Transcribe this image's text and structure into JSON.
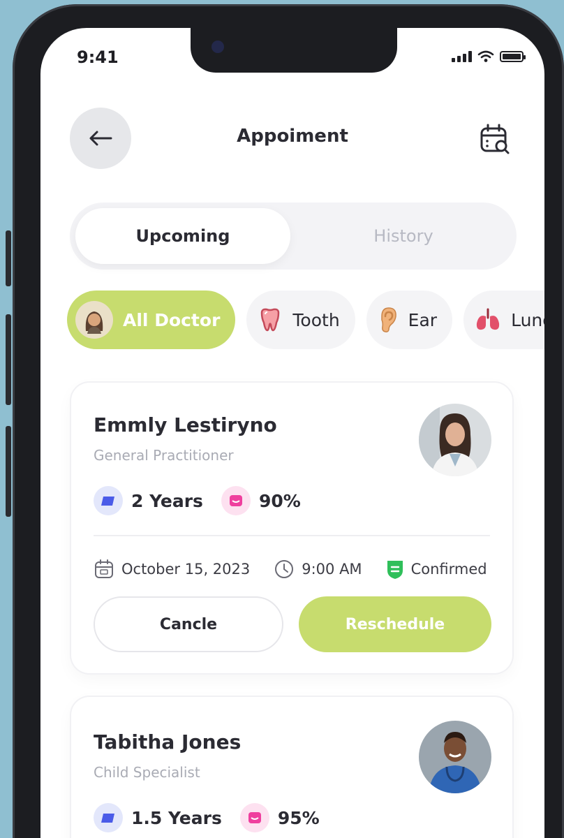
{
  "status_bar": {
    "time": "9:41"
  },
  "header": {
    "title": "Appoiment"
  },
  "tabs": [
    {
      "label": "Upcoming",
      "active": true
    },
    {
      "label": "History",
      "active": false
    }
  ],
  "filters": [
    {
      "label": "All Doctor",
      "icon": "doctor-avatar-icon",
      "active": true
    },
    {
      "label": "Tooth",
      "icon": "tooth-icon",
      "active": false
    },
    {
      "label": "Ear",
      "icon": "ear-icon",
      "active": false
    },
    {
      "label": "Lungs",
      "icon": "lungs-icon",
      "active": false
    }
  ],
  "appointments": [
    {
      "name": "Emmly Lestiryno",
      "specialty": "General Practitioner",
      "experience": "2 Years",
      "rating": "90%",
      "date": "October 15, 2023",
      "time": "9:00 AM",
      "status": "Confirmed",
      "cancel_label": "Cancle",
      "reschedule_label": "Reschedule"
    },
    {
      "name": "Tabitha Jones",
      "specialty": "Child Specialist",
      "experience": "1.5 Years",
      "rating": "95%"
    }
  ],
  "colors": {
    "accent": "#c7dc6e",
    "background": "#8fbfd1",
    "text": "#2b2b33",
    "muted": "#a9abb4",
    "status_green": "#2fbf5a",
    "experience_blue": "#4a5be8",
    "rating_pink": "#ef3f9e"
  }
}
